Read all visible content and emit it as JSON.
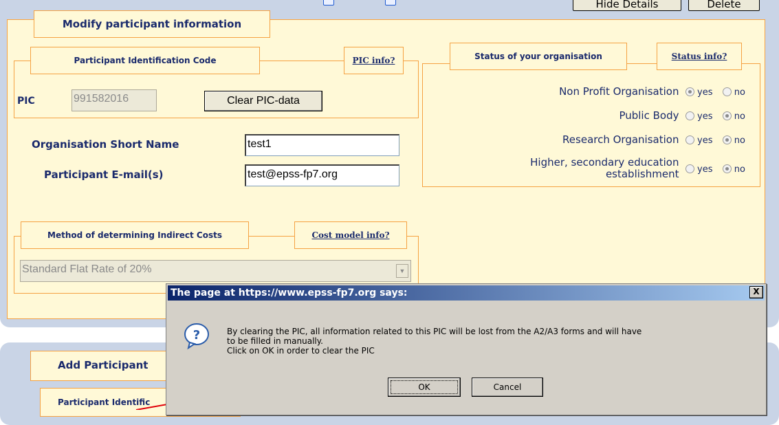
{
  "top": {
    "hide_details_label": "Hide Details",
    "delete_label": "Delete"
  },
  "participant_panel": {
    "title": "Modify participant information",
    "pic_section": {
      "title": "Participant Identification Code",
      "info_link": "PIC info?",
      "pic_label": "PIC",
      "pic_value": "991582016",
      "clear_button": "Clear PIC-data"
    },
    "short_name_label": "Organisation Short Name",
    "short_name_value": "test1",
    "email_label": "Participant E-mail(s)",
    "email_value": "test@epss-fp7.org",
    "status_section": {
      "title": "Status of your organisation",
      "info_link": "Status info?",
      "yes_label": "yes",
      "no_label": "no",
      "rows": [
        {
          "label": "Non Profit Organisation",
          "selected": "yes"
        },
        {
          "label": "Public Body",
          "selected": "no"
        },
        {
          "label": "Research Organisation",
          "selected": "no"
        },
        {
          "label_line1": "Higher, secondary education",
          "label_line2": "establishment",
          "selected": "no"
        }
      ]
    },
    "cost_section": {
      "title": "Method of determining Indirect Costs",
      "info_link": "Cost model info?",
      "selected_value": "Standard Flat Rate of 20%"
    }
  },
  "add_panel": {
    "title": "Add Participant",
    "pic_title": "Participant Identific"
  },
  "dialog": {
    "title": "The page at https://www.epss-fp7.org says:",
    "close_label": "X",
    "line1": "By clearing the PIC, all information related to this PIC will be lost from the A2/A3 forms and will have",
    "line2": "to be filled in manually.",
    "line3": "Click on OK in order to clear the PIC",
    "ok_label": "OK",
    "cancel_label": "Cancel",
    "icon": "question-icon"
  },
  "colors": {
    "panel_bg": "#fff9d7",
    "panel_border": "#f5a141",
    "label_text": "#1a2a6c",
    "annotation_arrow": "#e0000a"
  }
}
